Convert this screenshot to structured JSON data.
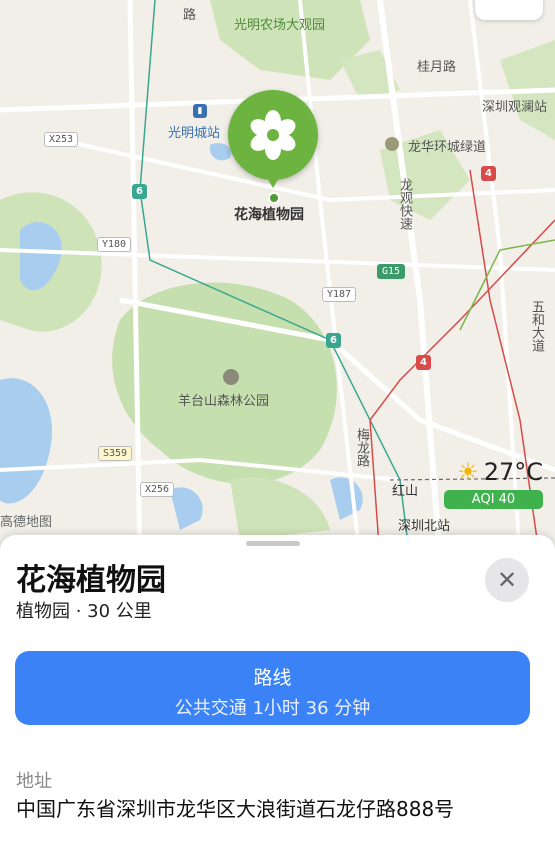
{
  "map": {
    "labels": {
      "farm_park": "光明农场大观园",
      "guangming_station": "光明城站",
      "longhua_greenway": "龙华环城绿道",
      "guilu": "桂月路",
      "shenzhen_guanlan": "深圳观澜站",
      "longguan_expressway": "龙观快速",
      "yangtaishan": "羊台山森林公园",
      "meilong": "梅龙路",
      "hongshan": "红山",
      "shenzhen_north": "深圳北站",
      "wuhe": "五和大道",
      "top_road": "路"
    },
    "shields": {
      "x253": "X253",
      "y180": "Y180",
      "y187": "Y187",
      "s359": "S359",
      "x256": "X256",
      "g15": "G15"
    },
    "route_badges": {
      "six_a": "6",
      "six_b": "6",
      "four_a": "4",
      "four_b": "4"
    },
    "pin": {
      "label": "花海植物园",
      "icon": "flower-icon"
    },
    "weather": {
      "temp": "27°C",
      "aqi": "AQI 40",
      "icon": "sun-icon"
    },
    "logo": "高德地图"
  },
  "sheet": {
    "title": "花海植物园",
    "subtitle": "植物园 · 30 公里",
    "close_icon": "close-icon",
    "route_button": {
      "label": "路线",
      "detail": "公共交通 1小时 36 分钟"
    },
    "address_label": "地址",
    "address": "中国广东省深圳市龙华区大浪街道石龙仔路888号"
  },
  "colors": {
    "accent": "#3b82f6",
    "pin": "#6db33f",
    "aqi": "#3fb24e"
  }
}
